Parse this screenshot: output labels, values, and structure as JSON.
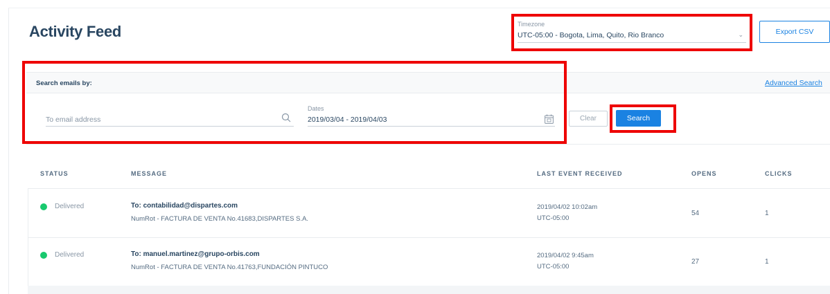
{
  "page": {
    "title": "Activity Feed"
  },
  "timezone": {
    "label": "Timezone",
    "value": "UTC-05:00 - Bogota, Lima, Quito, Rio Branco"
  },
  "toolbar": {
    "export_label": "Export CSV"
  },
  "search": {
    "header": "Search emails by:",
    "advanced_link": "Advanced Search",
    "email_placeholder": "To email address",
    "dates_label": "Dates",
    "dates_value": "2019/03/04 - 2019/04/03",
    "clear_label": "Clear",
    "search_label": "Search"
  },
  "table": {
    "columns": {
      "status": "STATUS",
      "message": "MESSAGE",
      "last_event": "LAST EVENT RECEIVED",
      "opens": "OPENS",
      "clicks": "CLICKS"
    },
    "rows": [
      {
        "status": "Delivered",
        "to": "To: contabilidad@dispartes.com",
        "subject": "NumRot - FACTURA DE VENTA No.41683,DISPARTES S.A.",
        "event_date": "2019/04/02 10:02am",
        "event_tz": "UTC-05:00",
        "opens": "54",
        "clicks": "1"
      },
      {
        "status": "Delivered",
        "to": "To: manuel.martinez@grupo-orbis.com",
        "subject": "NumRot - FACTURA DE VENTA No.41763,FUNDACIÓN PINTUCO",
        "event_date": "2019/04/02 9:45am",
        "event_tz": "UTC-05:00",
        "opens": "27",
        "clicks": "1"
      }
    ]
  },
  "colors": {
    "accent": "#1a82e2",
    "highlight_box": "#ee0000",
    "delivered": "#18c96e",
    "text_dark": "#294661"
  },
  "icons": {
    "search": "search-icon",
    "calendar": "calendar-icon",
    "chevron": "chevron-down-icon",
    "status": "status-dot-icon"
  }
}
